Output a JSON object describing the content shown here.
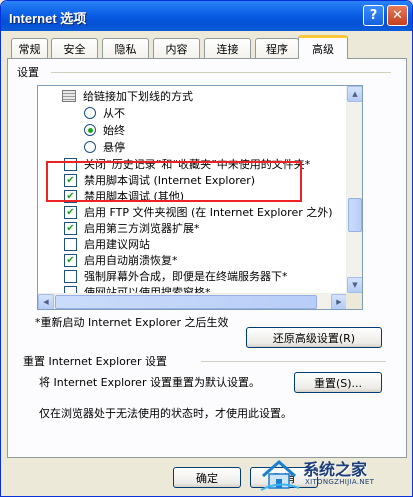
{
  "window": {
    "title": "Internet 选项",
    "help_glyph": "?",
    "close_glyph": "✕"
  },
  "tabs": [
    {
      "label": "常规"
    },
    {
      "label": "安全"
    },
    {
      "label": "隐私"
    },
    {
      "label": "内容"
    },
    {
      "label": "连接"
    },
    {
      "label": "程序"
    },
    {
      "label": "高级",
      "active": true
    }
  ],
  "settings": {
    "group_label": "设置",
    "items": [
      {
        "type": "group",
        "label": "给链接加下划线的方式"
      },
      {
        "type": "radio",
        "checked": false,
        "label": "从不"
      },
      {
        "type": "radio",
        "checked": true,
        "label": "始终"
      },
      {
        "type": "radio",
        "checked": false,
        "label": "悬停"
      },
      {
        "type": "checkbox",
        "checked": false,
        "label": "关闭“历史记录”和“收藏夹”中未使用的文件夹*"
      },
      {
        "type": "checkbox",
        "checked": true,
        "label": "禁用脚本调试 (Internet Explorer)"
      },
      {
        "type": "checkbox",
        "checked": true,
        "label": "禁用脚本调试 (其他)"
      },
      {
        "type": "checkbox",
        "checked": true,
        "label": "启用 FTP 文件夹视图 (在 Internet Explorer 之外)"
      },
      {
        "type": "checkbox",
        "checked": true,
        "label": "启用第三方浏览器扩展*"
      },
      {
        "type": "checkbox",
        "checked": false,
        "label": "启用建议网站"
      },
      {
        "type": "checkbox",
        "checked": true,
        "label": "启用自动崩溃恢复*"
      },
      {
        "type": "checkbox",
        "checked": false,
        "label": "强制屏幕外合成，即便是在终端服务器下*"
      },
      {
        "type": "checkbox",
        "checked": false,
        "label": "使网站可以使用搜索窗格*"
      }
    ],
    "scroll_position": 0.62,
    "restart_note": "*重新启动 Internet Explorer 之后生效",
    "restore_button": "还原高级设置(R)"
  },
  "reset": {
    "heading": "重置 Internet Explorer 设置",
    "description": "将 Internet Explorer 设置重置为默认设置。",
    "button": "重置(S)...",
    "note": "仅在浏览器处于无法使用的状态时，才使用此设置。"
  },
  "footer": {
    "ok_button": "确定",
    "cancel_button": "取消"
  },
  "watermark": {
    "text": "系统之家",
    "url": "XITONGZHIJIA.NET"
  },
  "colors": {
    "highlight_box": "#e22222",
    "check_mark": "#21a121",
    "title_bar": "#0a5ee6"
  }
}
